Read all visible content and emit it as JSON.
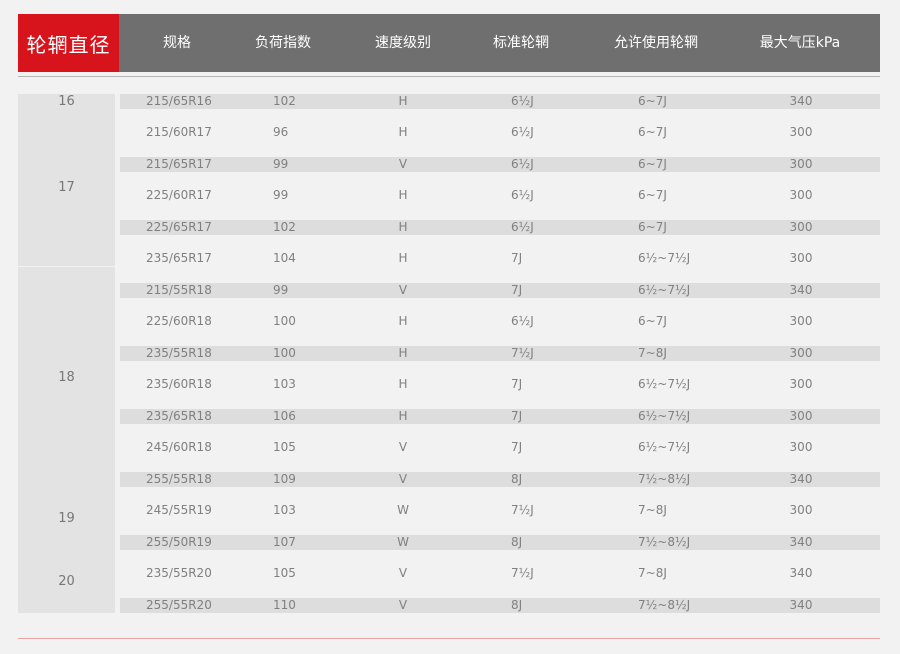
{
  "header": {
    "diameter": "轮辋直径",
    "columns": [
      "规格",
      "负荷指数",
      "速度级别",
      "标准轮辋",
      "允许使用轮辋",
      "最大气压kPa"
    ]
  },
  "groups": [
    {
      "label": "16",
      "rows": [
        [
          "215/65R16",
          "102",
          "H",
          "6½J",
          "6~7J",
          "340"
        ]
      ]
    },
    {
      "label": "17",
      "rows": [
        [
          "215/60R17",
          "96",
          "H",
          "6½J",
          "6~7J",
          "300"
        ],
        [
          "215/65R17",
          "99",
          "V",
          "6½J",
          "6~7J",
          "300"
        ],
        [
          "225/60R17",
          "99",
          "H",
          "6½J",
          "6~7J",
          "300"
        ],
        [
          "225/65R17",
          "102",
          "H",
          "6½J",
          "6~7J",
          "300"
        ],
        [
          "235/65R17",
          "104",
          "H",
          "7J",
          "6½~7½J",
          "300"
        ]
      ]
    },
    {
      "label": "18",
      "rows": [
        [
          "215/55R18",
          "99",
          "V",
          "7J",
          "6½~7½J",
          "340"
        ],
        [
          "225/60R18",
          "100",
          "H",
          "6½J",
          "6~7J",
          "300"
        ],
        [
          "235/55R18",
          "100",
          "H",
          "7½J",
          "7~8J",
          "300"
        ],
        [
          "235/60R18",
          "103",
          "H",
          "7J",
          "6½~7½J",
          "300"
        ],
        [
          "235/65R18",
          "106",
          "H",
          "7J",
          "6½~7½J",
          "300"
        ],
        [
          "245/60R18",
          "105",
          "V",
          "7J",
          "6½~7½J",
          "300"
        ],
        [
          "255/55R18",
          "109",
          "V",
          "8J",
          "7½~8½J",
          "340"
        ]
      ]
    },
    {
      "label": "19",
      "rows": [
        [
          "245/55R19",
          "103",
          "W",
          "7½J",
          "7~8J",
          "300"
        ],
        [
          "255/50R19",
          "107",
          "W",
          "8J",
          "7½~8½J",
          "340"
        ]
      ]
    },
    {
      "label": "20",
      "rows": [
        [
          "235/55R20",
          "105",
          "V",
          "7½J",
          "7~8J",
          "340"
        ],
        [
          "255/55R20",
          "110",
          "V",
          "8J",
          "7½~8½J",
          "340"
        ]
      ]
    }
  ]
}
